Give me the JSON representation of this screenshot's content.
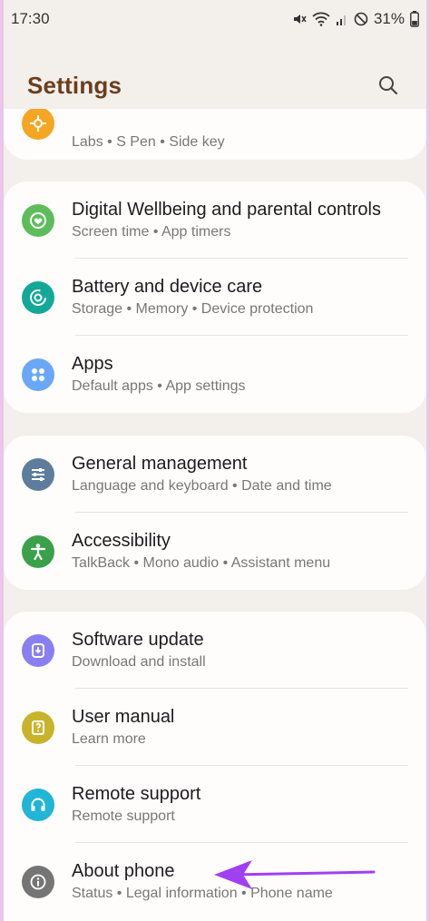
{
  "status_bar": {
    "time": "17:30",
    "battery": "31%"
  },
  "header": {
    "title": "Settings"
  },
  "groups": [
    {
      "items": [
        {
          "title": "",
          "subtitle_parts": [
            "Labs",
            "S Pen",
            "Side key"
          ],
          "icon": "advanced-features-icon",
          "color": "#f5a623"
        }
      ]
    },
    {
      "items": [
        {
          "title": "Digital Wellbeing and parental controls",
          "subtitle_parts": [
            "Screen time",
            "App timers"
          ],
          "icon": "wellbeing-icon",
          "color": "#5dbd5b"
        },
        {
          "title": "Battery and device care",
          "subtitle_parts": [
            "Storage",
            "Memory",
            "Device protection"
          ],
          "icon": "device-care-icon",
          "color": "#13a898"
        },
        {
          "title": "Apps",
          "subtitle_parts": [
            "Default apps",
            "App settings"
          ],
          "icon": "apps-grid-icon",
          "color": "#6aa8f7"
        }
      ]
    },
    {
      "items": [
        {
          "title": "General management",
          "subtitle_parts": [
            "Language and keyboard",
            "Date and time"
          ],
          "icon": "sliders-icon",
          "color": "#5e7d9c"
        },
        {
          "title": "Accessibility",
          "subtitle_parts": [
            "TalkBack",
            "Mono audio",
            "Assistant menu"
          ],
          "icon": "accessibility-person-icon",
          "color": "#3aa04a"
        }
      ]
    },
    {
      "items": [
        {
          "title": "Software update",
          "subtitle_parts": [
            "Download and install"
          ],
          "icon": "software-update-icon",
          "color": "#8a7ff0"
        },
        {
          "title": "User manual",
          "subtitle_parts": [
            "Learn more"
          ],
          "icon": "user-manual-icon",
          "color": "#c9b32b"
        },
        {
          "title": "Remote support",
          "subtitle_parts": [
            "Remote support"
          ],
          "icon": "headset-icon",
          "color": "#21b5d6"
        },
        {
          "title": "About phone",
          "subtitle_parts": [
            "Status",
            "Legal information",
            "Phone name"
          ],
          "icon": "info-icon",
          "color": "#757575"
        }
      ]
    }
  ],
  "annotation": {
    "arrow_color": "#a13ff2"
  },
  "subtitle_separator": " • "
}
